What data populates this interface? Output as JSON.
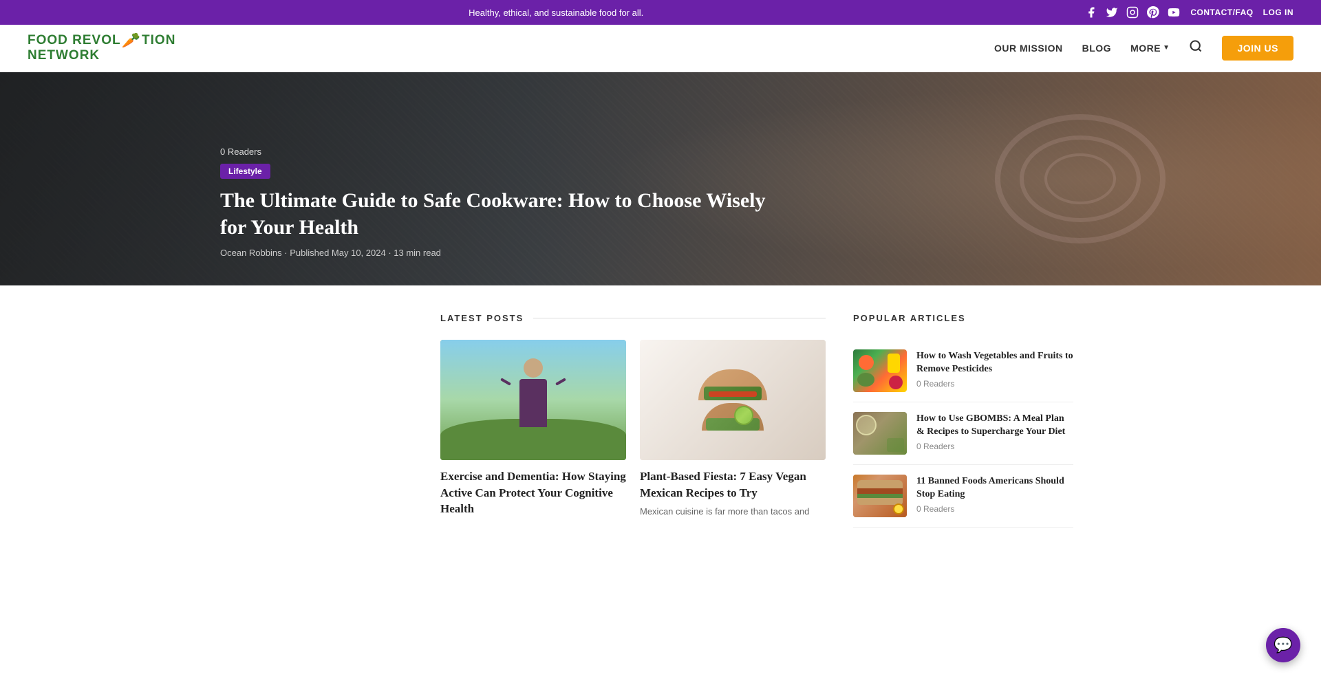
{
  "topbar": {
    "tagline": "Healthy, ethical, and sustainable food for all.",
    "links": [
      "CONTACT/FAQ",
      "LOG IN"
    ],
    "social": [
      "facebook",
      "twitter",
      "instagram",
      "pinterest",
      "youtube"
    ]
  },
  "header": {
    "logo": {
      "line1": "FOOD REVOL",
      "carrot": "🥕",
      "line2": "TION",
      "line3": "NETWORK"
    },
    "nav": [
      "OUR MISSION",
      "BLOG",
      "MORE"
    ],
    "join_label": "JOIN US"
  },
  "hero": {
    "readers": "0 Readers",
    "category": "Lifestyle",
    "title": "The Ultimate Guide to Safe Cookware: How to Choose Wisely for Your Health",
    "author": "Ocean Robbins",
    "published": "Published May 10, 2024",
    "read_time": "13 min read"
  },
  "latest_posts": {
    "section_title": "LATEST POSTS",
    "posts": [
      {
        "title": "Exercise and Dementia: How Staying Active Can Protect Your Cognitive Health",
        "excerpt": ""
      },
      {
        "title": "Plant-Based Fiesta: 7 Easy Vegan Mexican Recipes to Try",
        "excerpt": "Mexican cuisine is far more than tacos and"
      }
    ]
  },
  "popular_articles": {
    "section_title": "POPULAR ARTICLES",
    "articles": [
      {
        "title": "How to Wash Vegetables and Fruits to Remove Pesticides",
        "readers": "0 Readers",
        "thumb_type": "vegetables"
      },
      {
        "title": "How to Use GBOMBS: A Meal Plan & Recipes to Supercharge Your Diet",
        "readers": "0 Readers",
        "thumb_type": "gbombs"
      },
      {
        "title": "11 Banned Foods Americans Should Stop Eating",
        "readers": "0 Readers",
        "thumb_type": "banned"
      }
    ]
  },
  "chat": {
    "icon": "💬"
  }
}
